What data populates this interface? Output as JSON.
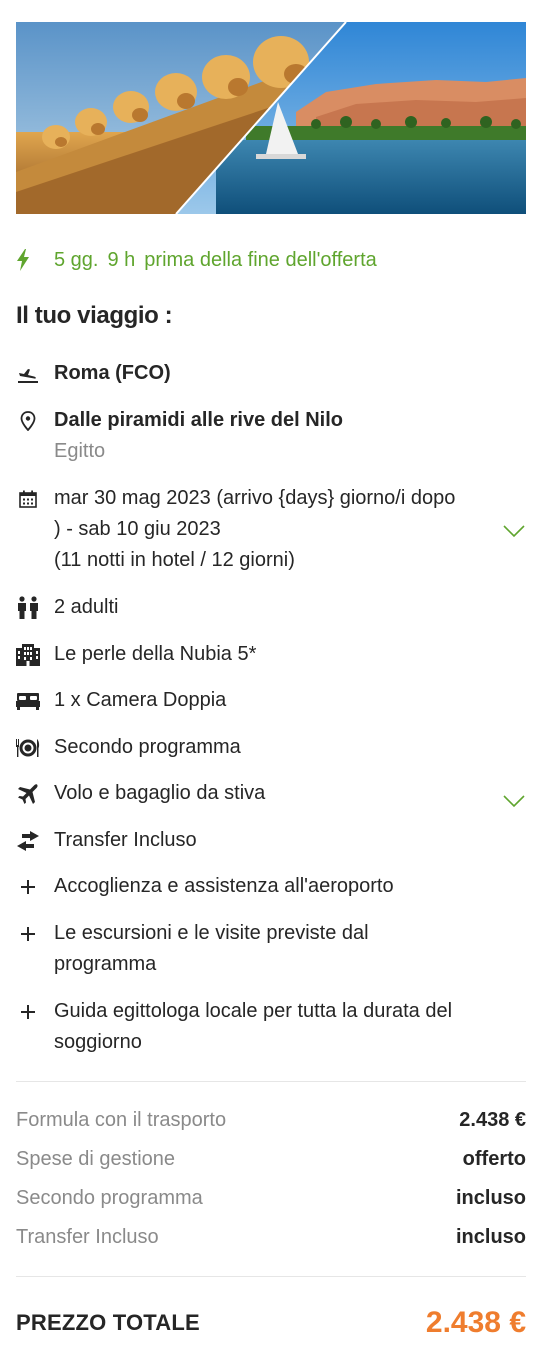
{
  "timer": {
    "days": "5 gg.",
    "hours": "9 h",
    "text": "prima della fine dell'offerta"
  },
  "heading": "Il tuo viaggio :",
  "trip": {
    "departure": "Roma (FCO)",
    "destination_title": "Dalle piramidi alle rive del Nilo",
    "destination_country": "Egitto",
    "dates_line1": "mar 30 mag 2023 (arrivo {days} giorno/i dopo",
    "dates_line2": ") - sab 10 giu 2023",
    "dates_line3": "(11 notti in hotel / 12 giorni)",
    "travellers": "2 adulti",
    "hotel": "Le perle della Nubia 5*",
    "room": "1 x Camera Doppia",
    "board": "Secondo programma",
    "flight": "Volo e bagaglio da stiva",
    "transfer": "Transfer Incluso",
    "extra1": "Accoglienza e assistenza all'aeroporto",
    "extra2_line1": "Le escursioni e le visite previste dal",
    "extra2_line2": "programma",
    "extra3_line1": "Guida egittologa locale per tutta la durata del",
    "extra3_line2": "soggiorno"
  },
  "price": {
    "rows": [
      {
        "label": "Formula con il trasporto",
        "value": "2.438 €"
      },
      {
        "label": "Spese di gestione",
        "value": "offerto"
      },
      {
        "label": "Secondo programma",
        "value": "incluso"
      },
      {
        "label": "Transfer Incluso",
        "value": "incluso"
      }
    ],
    "total_label": "PREZZO TOTALE",
    "total_value": "2.438 €"
  },
  "colors": {
    "accent_green": "#5fa52e",
    "price_orange": "#ef7d2e",
    "text": "#262626",
    "muted": "#8a8a8a"
  }
}
